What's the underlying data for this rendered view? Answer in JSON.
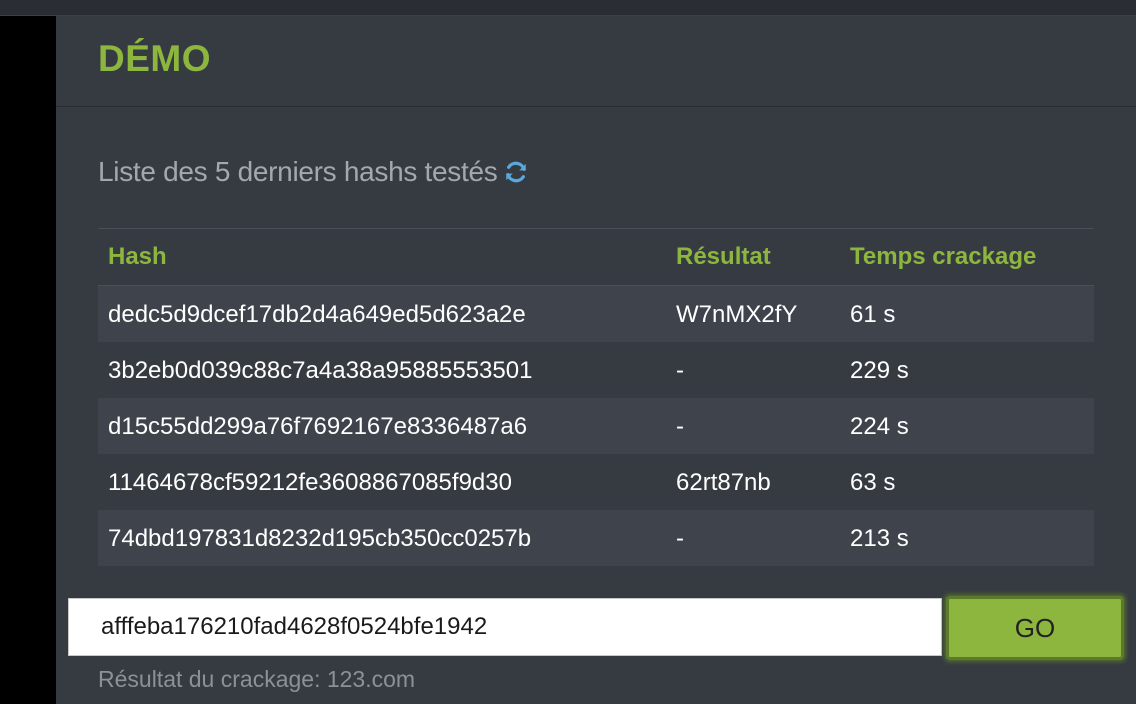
{
  "panel": {
    "title": "DÉMO",
    "subtitle": "Liste des 5 derniers hashs testés",
    "accent_color": "#8db63f",
    "refresh_icon": "refresh-icon"
  },
  "table": {
    "headers": [
      "Hash",
      "Résultat",
      "Temps crackage"
    ],
    "rows": [
      {
        "hash": "dedc5d9dcef17db2d4a649ed5d623a2e",
        "result": "W7nMX2fY",
        "time": "61 s"
      },
      {
        "hash": "3b2eb0d039c88c7a4a38a95885553501",
        "result": "-",
        "time": "229 s"
      },
      {
        "hash": "d15c55dd299a76f7692167e8336487a6",
        "result": "-",
        "time": "224 s"
      },
      {
        "hash": "11464678cf59212fe3608867085f9d30",
        "result": "62rt87nb",
        "time": "63 s"
      },
      {
        "hash": "74dbd197831d8232d195cb350cc0257b",
        "result": "-",
        "time": "213 s"
      }
    ]
  },
  "form": {
    "input_value": "afffeba176210fad4628f0524bfe1942",
    "go_label": "GO",
    "result_text": "Résultat du crackage: 123.com"
  }
}
